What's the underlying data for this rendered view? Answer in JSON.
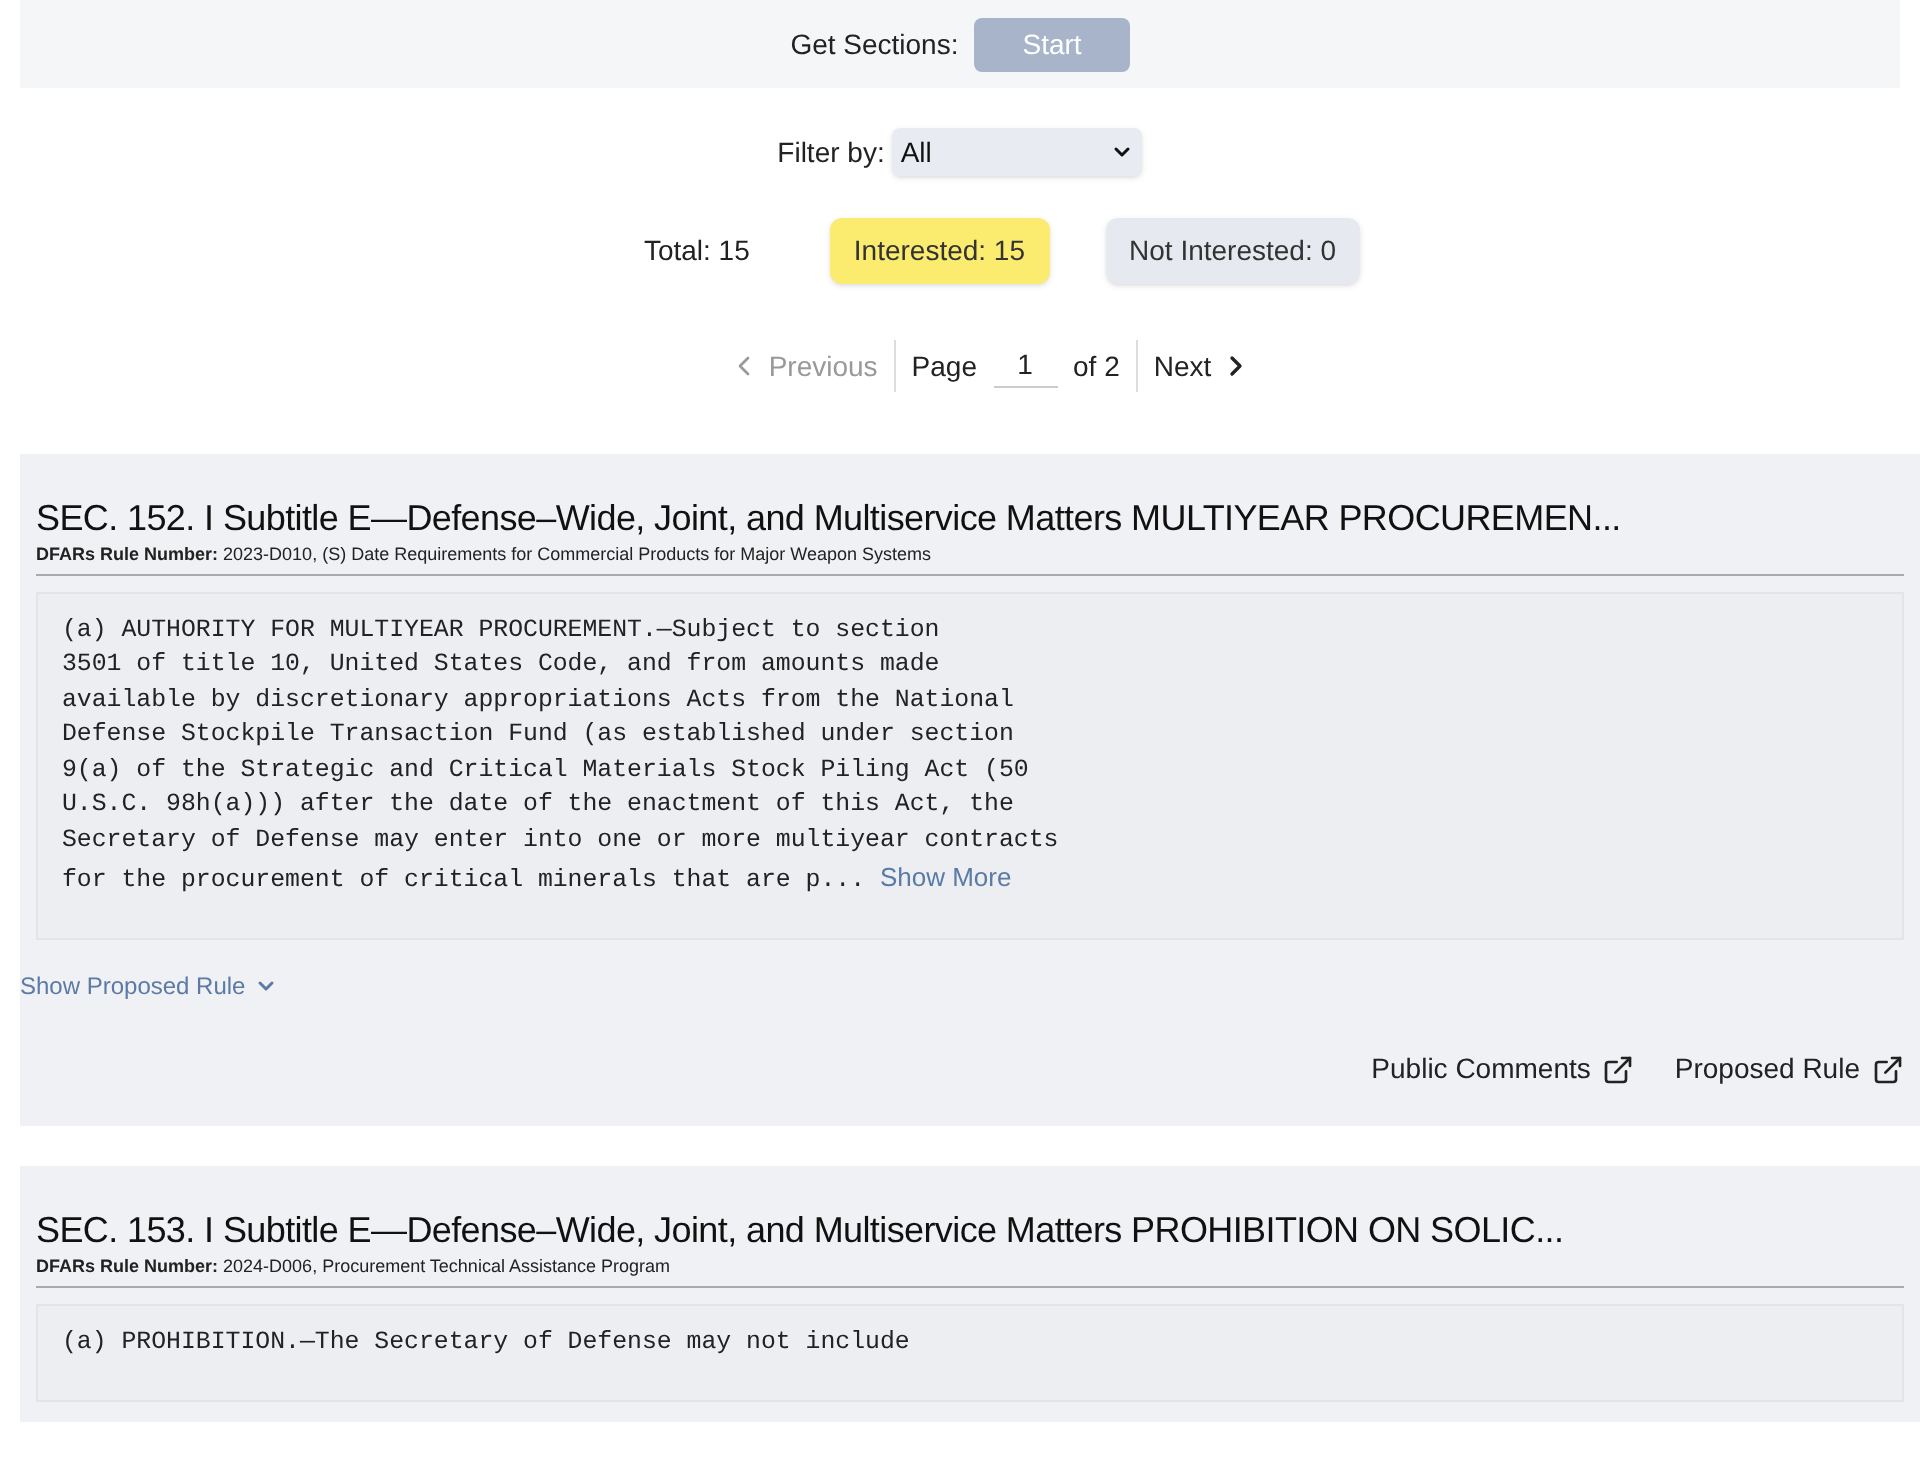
{
  "get_sections": {
    "label": "Get Sections:",
    "button": "Start",
    "disabled": true
  },
  "filter": {
    "label": "Filter by:",
    "value": "All"
  },
  "counts": [
    {
      "kind": "plain",
      "label": "Total: 15"
    },
    {
      "kind": "highlight",
      "label": "Interested: 15"
    },
    {
      "kind": "chip",
      "label": "Not Interested: 0"
    }
  ],
  "pagination": {
    "previous": "Previous",
    "previous_disabled": true,
    "page_label": "Page",
    "page": "1",
    "of": "of 2",
    "next": "Next"
  },
  "sections": [
    {
      "title": "SEC. 152. I Subtitle E—Defense–Wide, Joint, and Multiservice Matters MULTIYEAR PROCUREMEN...",
      "rule_label": "DFARs Rule Number:",
      "rule": "2023-D010, (S) Date Requirements for Commercial Products for Major Weapon Systems",
      "text": "(a) AUTHORITY FOR MULTIYEAR PROCUREMENT.—Subject to section\n3501 of title 10, United States Code, and from amounts made\navailable by discretionary appropriations Acts from the National\nDefense Stockpile Transaction Fund (as established under section\n9(a) of the Strategic and Critical Materials Stock Piling Act (50\nU.S.C. 98h(a))) after the date of the enactment of this Act, the\nSecretary of Defense may enter into one or more multiyear contracts\nfor the procurement of critical minerals that are p...",
      "show_more": "Show More",
      "toggle": "Show Proposed Rule",
      "expanded": false,
      "links": [
        "Public Comments",
        "Proposed Rule"
      ]
    },
    {
      "title": "SEC. 153. I Subtitle E—Defense–Wide, Joint, and Multiservice Matters PROHIBITION ON SOLIC...",
      "rule_label": "DFARs Rule Number:",
      "rule": "2024-D006, Procurement Technical Assistance Program",
      "text": "(a) PROHIBITION.—The Secretary of Defense may not include"
    }
  ]
}
